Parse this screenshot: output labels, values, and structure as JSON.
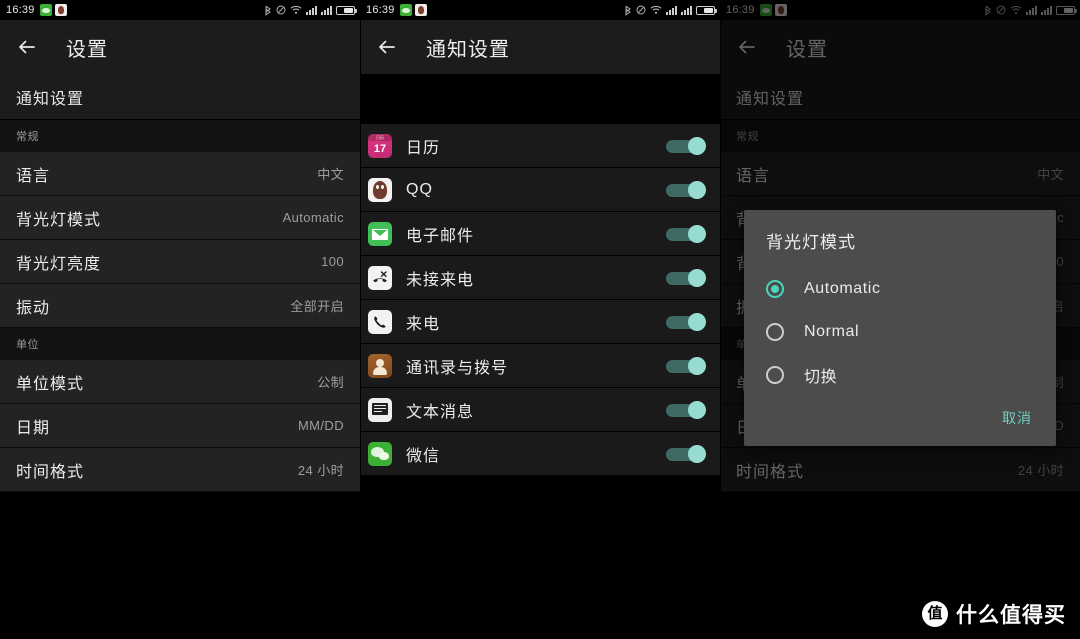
{
  "status_bar": {
    "time": "16:39",
    "left_icons": [
      "wechat-notification-icon",
      "qq-notification-icon"
    ],
    "right_icons": [
      "bluetooth-icon",
      "mute-icon",
      "wifi-icon",
      "signal-icon-1",
      "signal-icon-2",
      "battery-icon"
    ]
  },
  "panel1": {
    "appbar": {
      "title": "设置",
      "back_icon": "back-arrow-icon"
    },
    "primary_row": {
      "label": "通知设置"
    },
    "sections": [
      {
        "header": "常规",
        "rows": [
          {
            "label": "语言",
            "value": "中文"
          },
          {
            "label": "背光灯模式",
            "value": "Automatic"
          },
          {
            "label": "背光灯亮度",
            "value": "100"
          },
          {
            "label": "振动",
            "value": "全部开启"
          }
        ]
      },
      {
        "header": "单位",
        "rows": [
          {
            "label": "单位模式",
            "value": "公制"
          },
          {
            "label": "日期",
            "value": "MM/DD"
          },
          {
            "label": "时间格式",
            "value": "24 小时"
          }
        ]
      }
    ]
  },
  "panel2": {
    "appbar": {
      "title": "通知设置",
      "back_icon": "back-arrow-icon"
    },
    "apps": [
      {
        "name": "日历",
        "icon": "calendar-icon",
        "icon_text": "17",
        "icon_top_text": "日历",
        "enabled": true
      },
      {
        "name": "QQ",
        "icon": "qq-icon",
        "enabled": true
      },
      {
        "name": "电子邮件",
        "icon": "email-icon",
        "enabled": true
      },
      {
        "name": "未接来电",
        "icon": "missed-call-icon",
        "enabled": true
      },
      {
        "name": "来电",
        "icon": "incoming-call-icon",
        "enabled": true
      },
      {
        "name": "通讯录与拨号",
        "icon": "contacts-icon",
        "enabled": true
      },
      {
        "name": "文本消息",
        "icon": "sms-icon",
        "enabled": true
      },
      {
        "name": "微信",
        "icon": "wechat-icon",
        "enabled": true
      }
    ]
  },
  "panel3": {
    "appbar": {
      "title": "设置",
      "back_icon": "back-arrow-icon"
    },
    "primary_row": {
      "label": "通知设置"
    },
    "sections": [
      {
        "header": "常规",
        "rows": [
          {
            "label": "语言",
            "value": "中文"
          },
          {
            "label": "背光灯模式",
            "value": "Automatic"
          },
          {
            "label": "背光灯亮度",
            "value": "100"
          },
          {
            "label": "振动",
            "value": "全部开启"
          }
        ]
      },
      {
        "header": "单位",
        "rows": [
          {
            "label": "单位模式",
            "value": "公制"
          },
          {
            "label": "日期",
            "value": "MM/DD"
          },
          {
            "label": "时间格式",
            "value": "24 小时"
          }
        ]
      }
    ],
    "dialog": {
      "title": "背光灯模式",
      "options": [
        {
          "label": "Automatic",
          "selected": true
        },
        {
          "label": "Normal",
          "selected": false
        },
        {
          "label": "切换",
          "selected": false
        }
      ],
      "cancel_label": "取消"
    }
  },
  "watermark": {
    "logo_char": "值",
    "text": "什么值得买"
  },
  "colors": {
    "accent_teal": "#4cd5bd",
    "toggle_thumb": "#97dcd2",
    "toggle_track": "#3e6a64",
    "appbar_bg": "#1c1c1c",
    "row_bg": "#232323",
    "dialog_bg": "#4c4c4c"
  }
}
